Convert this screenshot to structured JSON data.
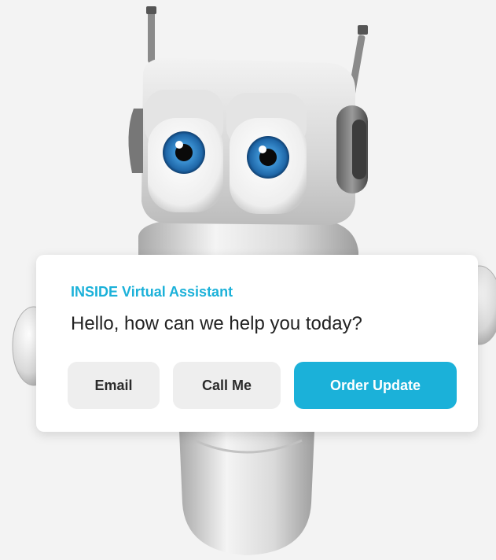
{
  "assistant": {
    "title": "INSIDE Virtual Assistant",
    "message": "Hello, how can we help you today?",
    "buttons": {
      "email": "Email",
      "call": "Call Me",
      "order": "Order Update"
    }
  },
  "colors": {
    "accent": "#1bb1d9",
    "button_bg": "#eeeeee",
    "text": "#222222"
  },
  "icons": [
    "robot-mascot-illustration"
  ]
}
